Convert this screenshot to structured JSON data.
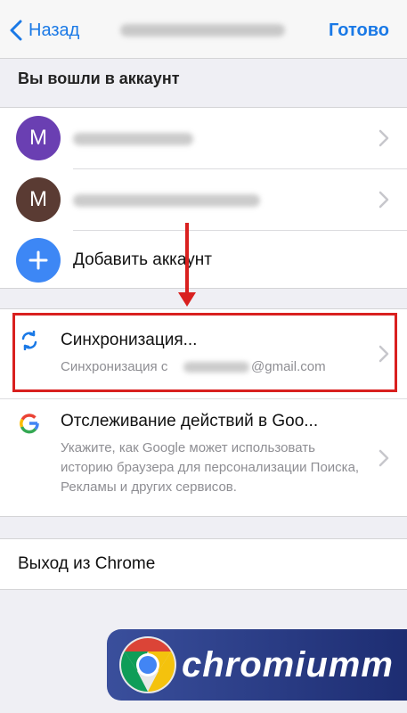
{
  "nav": {
    "back_label": "Назад",
    "done_label": "Готово"
  },
  "accounts": {
    "header": "Вы вошли в аккаунт",
    "items": [
      {
        "initial": "M",
        "color": "#6a3fb2"
      },
      {
        "initial": "M",
        "color": "#5a3b33"
      }
    ],
    "add_label": "Добавить аккаунт"
  },
  "sync": {
    "title": "Синхронизация...",
    "subtitle_prefix": "Синхронизация с",
    "subtitle_suffix": "@gmail.com"
  },
  "activity": {
    "title": "Отслеживание действий в Goo...",
    "description": "Укажите, как Google может использовать историю браузера для персонализации Поиска, Рекламы и других сервисов."
  },
  "signout": {
    "label": "Выход из Chrome"
  },
  "watermark": {
    "text": "chromiumm"
  },
  "colors": {
    "accent": "#1a79e6",
    "highlight": "#d9201f",
    "add_button": "#3d87f5"
  }
}
